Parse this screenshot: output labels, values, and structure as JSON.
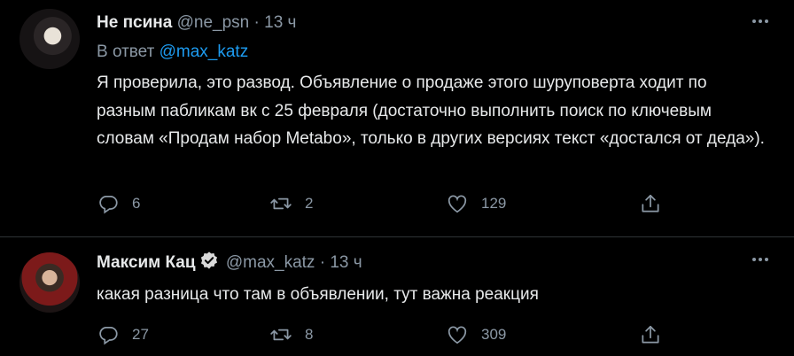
{
  "tweets": [
    {
      "name": "Не псина",
      "handle": "@ne_psn",
      "separator": "·",
      "time": "13 ч",
      "reply_prefix": "В ответ",
      "reply_to": "@max_katz",
      "text": "Я проверила, это развод. Объявление о продаже этого шуруповерта ходит по разным пабликам вк с 25 февраля (достаточно выполнить поиск по ключевым словам «Продам набор Metabo», только в других версиях текст «достался от деда»).",
      "replies": "6",
      "retweets": "2",
      "likes": "129",
      "icons": {
        "reply": "comment-icon",
        "retweet": "retweet-icon",
        "like": "heart-icon",
        "share": "share-icon",
        "more": "more-icon"
      }
    },
    {
      "name": "Максим Кац",
      "handle": "@max_katz",
      "separator": "·",
      "time": "13 ч",
      "verified": true,
      "text": "какая разница что там в объявлении, тут важна реакция",
      "replies": "27",
      "retweets": "8",
      "likes": "309",
      "icons": {
        "reply": "comment-icon",
        "retweet": "retweet-icon",
        "like": "heart-icon",
        "share": "share-icon",
        "more": "more-icon"
      }
    }
  ],
  "colors": {
    "background": "#000000",
    "text": "#e7e9ea",
    "secondary": "#8b98a5",
    "link": "#1d9bf0",
    "divider": "#2f3336"
  }
}
